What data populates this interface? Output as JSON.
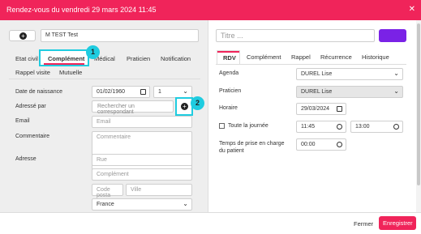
{
  "header": {
    "title": "Rendez-vous du vendredi 29 mars 2024 11:45",
    "close_glyph": "✕"
  },
  "left": {
    "patient_name": "M TEST Test",
    "tabs": [
      "Etat civil",
      "Complément",
      "Médical",
      "Praticien",
      "Notification",
      "Rappel visite",
      "Mutuelle"
    ],
    "active_tab": "Complément",
    "fields": {
      "birth_label": "Date de naissance",
      "birth_value": "01/02/1960",
      "birth_count": "1",
      "adresse_par_label": "Adressé par",
      "correspondant_placeholder": "Rechercher un correspondant",
      "email_label": "Email",
      "email_placeholder": "Email",
      "comment_label": "Commentaire",
      "comment_placeholder": "Commentaire",
      "address_label": "Adresse",
      "rue_placeholder": "Rue",
      "complement_placeholder": "Complément",
      "cp_placeholder": "Code posta",
      "ville_placeholder": "Ville",
      "country_value": "France"
    }
  },
  "right": {
    "title_placeholder": "Titre ...",
    "tabs": [
      "RDV",
      "Complément",
      "Rappel",
      "Récurrence",
      "Historique"
    ],
    "active_tab": "RDV",
    "agenda_label": "Agenda",
    "agenda_value": "DUREL Lise",
    "praticien_label": "Praticien",
    "praticien_value": "DUREL Lise",
    "horaire_label": "Horaire",
    "horaire_date": "29/03/2024",
    "allday_label": "Toute la journée",
    "time_start": "11:45",
    "time_end": "13:00",
    "duree_label_1": "Temps de prise en charge",
    "duree_label_2": "du patient",
    "duree_value": "00:00"
  },
  "footer": {
    "close_label": "Fermer",
    "save_label": "Enregistrer"
  },
  "annotations": [
    "1",
    "2"
  ],
  "colors": {
    "brand": "#f0245a",
    "purple": "#7a22e6",
    "highlight": "#1fcce0"
  }
}
